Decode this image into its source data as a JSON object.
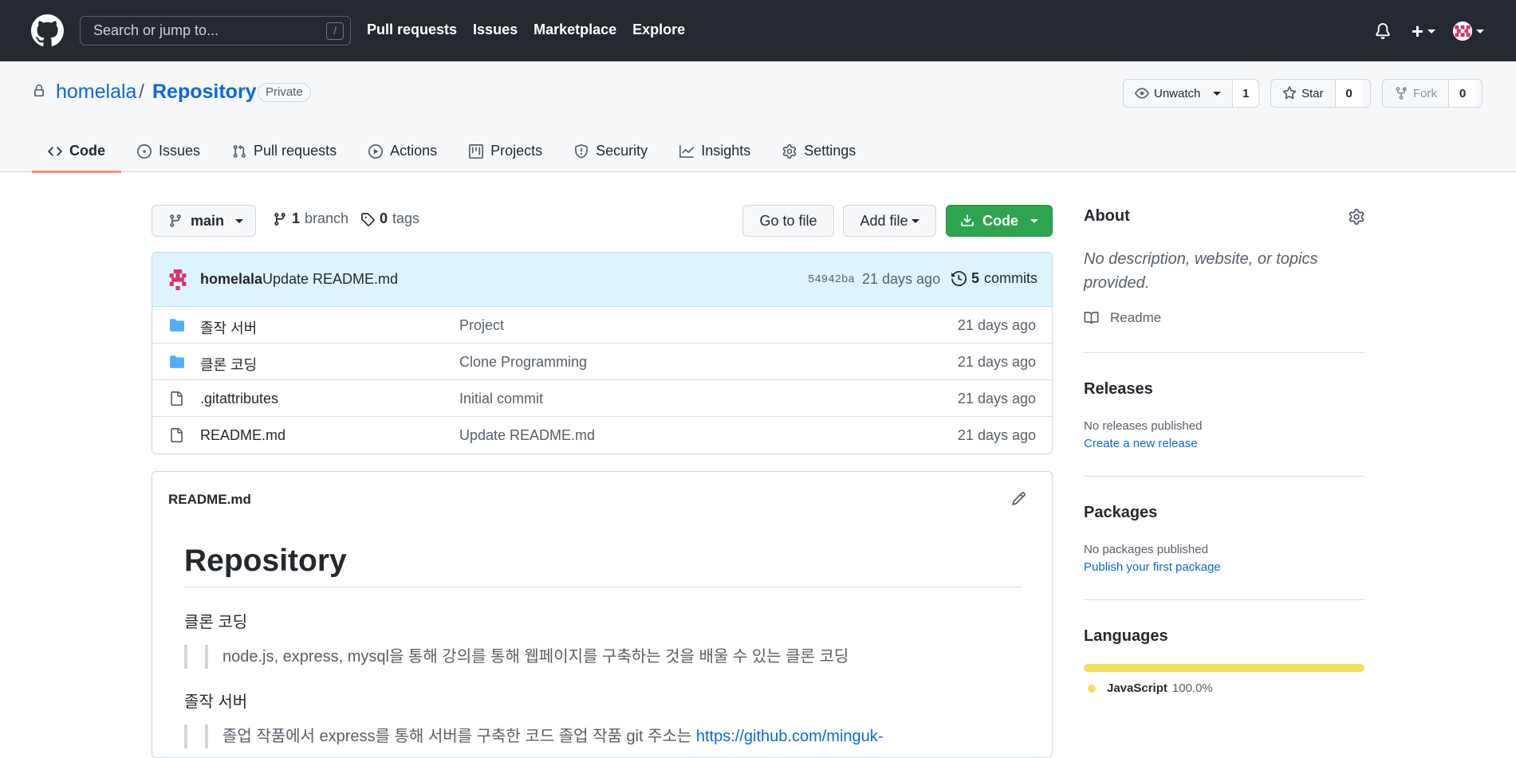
{
  "header": {
    "search_placeholder": "Search or jump to...",
    "slash_key": "/",
    "nav": [
      "Pull requests",
      "Issues",
      "Marketplace",
      "Explore"
    ],
    "plus": "+"
  },
  "repo": {
    "owner": "homelala",
    "separator": "/",
    "name": "Repository",
    "visibility": "Private",
    "unwatch_label": "Unwatch",
    "watch_count": "1",
    "star_label": "Star",
    "star_count": "0",
    "fork_label": "Fork",
    "fork_count": "0"
  },
  "tabs": [
    "Code",
    "Issues",
    "Pull requests",
    "Actions",
    "Projects",
    "Security",
    "Insights",
    "Settings"
  ],
  "toolbar": {
    "branch": "main",
    "branch_count": "1",
    "branch_label": "branch",
    "tag_count": "0",
    "tag_label": "tags",
    "go_to_file": "Go to file",
    "add_file": "Add file",
    "code": "Code"
  },
  "commit": {
    "author": "homelala",
    "message": "Update README.md",
    "sha": "54942ba",
    "time": "21 days ago",
    "commit_count": "5",
    "commit_label": "commits"
  },
  "files": [
    {
      "name": "졸작 서버",
      "type": "folder",
      "message": "Project",
      "date": "21 days ago"
    },
    {
      "name": "클론 코딩",
      "type": "folder",
      "message": "Clone Programming",
      "date": "21 days ago"
    },
    {
      "name": ".gitattributes",
      "type": "file",
      "message": "Initial commit",
      "date": "21 days ago"
    },
    {
      "name": "README.md",
      "type": "file",
      "message": "Update README.md",
      "date": "21 days ago"
    }
  ],
  "readme": {
    "filename": "README.md",
    "h1": "Repository",
    "section1": "클론 코딩",
    "quote1": "node.js, express, mysql을 통해 강의를 통해 웹페이지를 구축하는 것을 배울 수 있는 클론 코딩",
    "section2": "졸작 서버",
    "quote2": "졸업 작품에서 express를 통해 서버를 구축한 코드 졸업 작품 git 주소는 ",
    "quote2_link": "https://github.com/minguk-"
  },
  "sidebar": {
    "about_title": "About",
    "about_desc": "No description, website, or topics provided.",
    "readme_label": "Readme",
    "releases_title": "Releases",
    "releases_text": "No releases published",
    "releases_link": "Create a new release",
    "packages_title": "Packages",
    "packages_text": "No packages published",
    "packages_link": "Publish your first package",
    "languages_title": "Languages",
    "language_name": "JavaScript",
    "language_pct": "100.0%",
    "language_color": "#f1e05a",
    "language_fraction": 1.0
  },
  "colors": {
    "header_bg": "#24292f",
    "link": "#0969da",
    "green_button": "#2da44e",
    "active_tab_underline": "#fd8c73",
    "folder": "#54aeff"
  }
}
